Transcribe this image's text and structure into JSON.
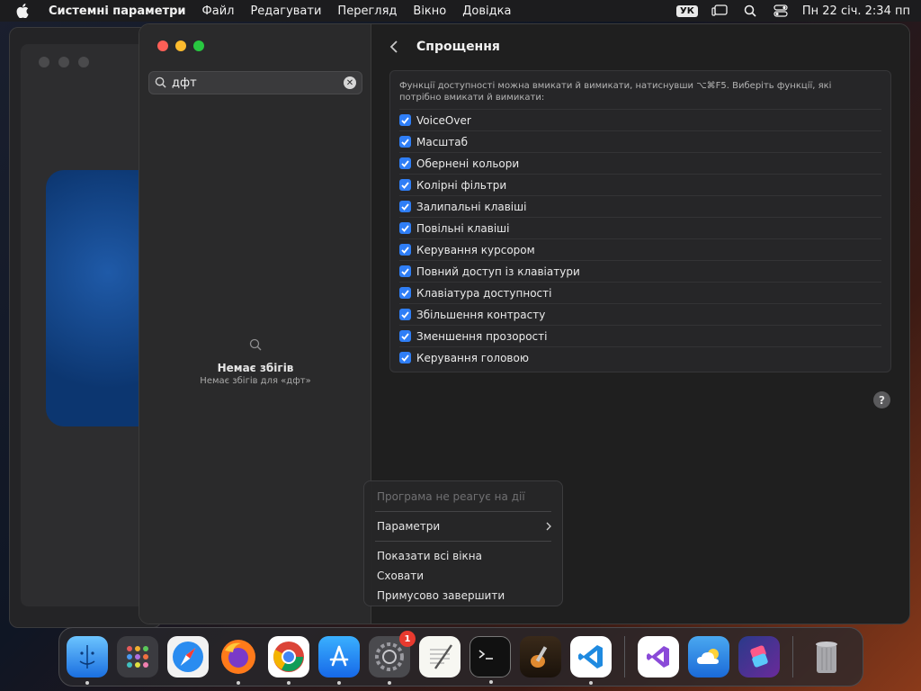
{
  "menubar": {
    "app_name": "Системні параметри",
    "items": [
      "Файл",
      "Редагувати",
      "Перегляд",
      "Вікно",
      "Довідка"
    ],
    "language": "УК",
    "clock": "Пн 22 січ.  2:34 пп"
  },
  "sidebar": {
    "search_value": "дфт",
    "no_results_title": "Немає збігів",
    "no_results_subtitle": "Немає збігів для «дфт»"
  },
  "content": {
    "title": "Спрощення",
    "description": "Функції доступності можна вмикати й вимикати, натиснувши ⌥⌘F5. Виберіть функції, які потрібно вмикати й вимикати:",
    "options": [
      {
        "label": "VoiceOver",
        "checked": true
      },
      {
        "label": "Масштаб",
        "checked": true
      },
      {
        "label": "Обернені кольори",
        "checked": true
      },
      {
        "label": "Колірні фільтри",
        "checked": true
      },
      {
        "label": "Залипальні клавіші",
        "checked": true
      },
      {
        "label": "Повільні клавіші",
        "checked": true
      },
      {
        "label": "Керування курсором",
        "checked": true
      },
      {
        "label": "Повний доступ із клавіатури",
        "checked": true
      },
      {
        "label": "Клавіатура доступності",
        "checked": true
      },
      {
        "label": "Збільшення контрасту",
        "checked": true
      },
      {
        "label": "Зменшення прозорості",
        "checked": true
      },
      {
        "label": "Керування головою",
        "checked": true
      }
    ],
    "help_label": "?"
  },
  "context_menu": {
    "not_responding": "Програма не реагує на дії",
    "parameters": "Параметри",
    "show_all_windows": "Показати всі вікна",
    "hide": "Сховати",
    "force_quit": "Примусово завершити"
  },
  "dock": {
    "settings_badge": "1"
  },
  "colors": {
    "accent": "#2f7ef6",
    "badge": "#e83a2f"
  }
}
